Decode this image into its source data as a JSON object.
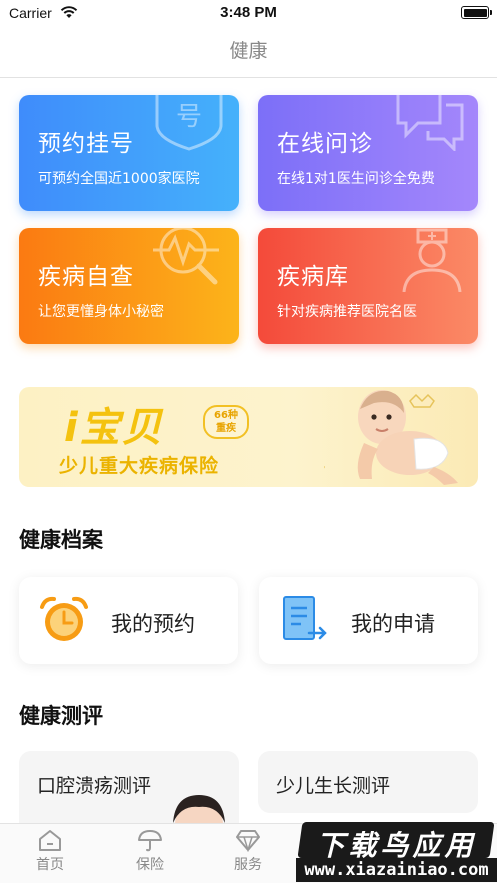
{
  "status_bar": {
    "carrier": "Carrier",
    "time": "3:48 PM",
    "wifi_icon": "wifi-icon",
    "battery_icon": "battery-icon"
  },
  "header": {
    "title": "健康"
  },
  "quick_services": [
    {
      "title": "预约挂号",
      "subtitle": "可预约全国近1000家医院",
      "icon": "number-tag-icon",
      "color_start": "#3f8cfb",
      "color_end": "#45b1fb"
    },
    {
      "title": "在线问诊",
      "subtitle": "在线1对1医生问诊全免费",
      "icon": "chat-bubbles-icon",
      "color_start": "#7c6ff8",
      "color_end": "#a487fb"
    },
    {
      "title": "疾病自查",
      "subtitle": "让您更懂身体小秘密",
      "icon": "magnifier-pulse-icon",
      "color_start": "#fb7a12",
      "color_end": "#fcb41a"
    },
    {
      "title": "疾病库",
      "subtitle": "针对疾病推荐医院名医",
      "icon": "doctor-icon",
      "color_start": "#f44a3a",
      "color_end": "#fb8a66"
    }
  ],
  "banner": {
    "brand": "i宝贝",
    "badge_line1": "66种",
    "badge_line2": "重疾",
    "tagline": "少儿重大疾病保险"
  },
  "health_records": {
    "title": "健康档案",
    "items": [
      {
        "label": "我的预约",
        "icon": "alarm-clock-icon"
      },
      {
        "label": "我的申请",
        "icon": "document-export-icon"
      }
    ]
  },
  "health_evaluation": {
    "title": "健康测评",
    "items": [
      {
        "label": "口腔溃疡测评"
      },
      {
        "label": "少儿生长测评"
      }
    ]
  },
  "tab_bar": {
    "items": [
      {
        "label": "首页",
        "icon": "home-icon"
      },
      {
        "label": "保险",
        "icon": "umbrella-icon"
      },
      {
        "label": "服务",
        "icon": "diamond-icon"
      }
    ]
  },
  "watermark": {
    "brand": "下载鸟应用",
    "url": "www.xiazainiao.com"
  }
}
